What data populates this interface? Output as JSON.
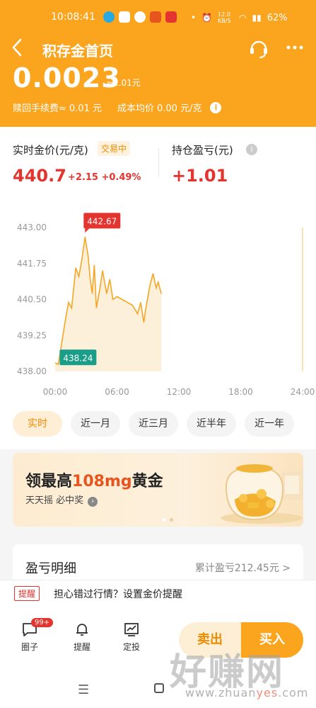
{
  "status": {
    "time": "10:08:41",
    "net_speed": "12.0 KB/S",
    "battery": "62%"
  },
  "header": {
    "title": "积存金首页",
    "grams": "0.0023",
    "grams_approx": "≈1.01元",
    "fee_label": "赎回手续费≈",
    "fee_value": "0.01 元",
    "cost_label": "成本均价",
    "cost_value": "0.00 元/克"
  },
  "price_panel": {
    "price_label": "实时金价(元/克)",
    "trading_badge": "交易中",
    "price": "440.7",
    "change": "+2.15 +0.49%",
    "pnl_label": "持仓盈亏(元)",
    "pnl_value": "+1.01"
  },
  "chart_data": {
    "type": "line",
    "x_ticks": [
      "00:00",
      "06:00",
      "12:00",
      "18:00",
      "24:00"
    ],
    "y_ticks": [
      "443.00",
      "441.75",
      "440.50",
      "439.25",
      "438.00"
    ],
    "ylim": [
      438.0,
      443.0
    ],
    "xlim_hours": [
      0,
      24
    ],
    "high_label": "442.67",
    "low_label": "438.24",
    "series": [
      {
        "x": [
          0.0,
          0.3,
          0.6,
          1.0,
          1.3,
          1.6,
          2.0,
          2.3,
          2.6,
          2.9,
          3.2,
          3.4,
          3.6,
          3.8,
          4.0,
          4.3,
          4.6,
          5.0,
          5.3,
          5.6,
          6.0,
          6.5,
          7.0,
          7.5,
          8.0,
          8.3,
          8.6,
          8.8,
          9.0,
          9.2,
          9.5,
          9.8,
          10.0,
          10.3
        ],
        "y": [
          438.3,
          438.24,
          438.9,
          439.8,
          440.4,
          440.2,
          441.6,
          441.3,
          441.9,
          442.67,
          442.0,
          441.2,
          440.7,
          441.7,
          440.2,
          440.8,
          441.5,
          440.7,
          441.2,
          440.5,
          440.6,
          440.5,
          440.4,
          440.3,
          440.0,
          440.4,
          439.7,
          440.2,
          440.6,
          441.0,
          441.4,
          440.9,
          441.1,
          440.7
        ]
      }
    ]
  },
  "ranges": [
    "实时",
    "近一月",
    "近三月",
    "近半年",
    "近一年"
  ],
  "banner": {
    "title_pre": "领最高",
    "title_hl": "108mg",
    "title_post": "黄金",
    "sub": "天天摇 必中奖"
  },
  "pnl_card": {
    "title": "盈亏明细",
    "total": "累计盈亏212.45元 >"
  },
  "alert": {
    "tag": "提醒",
    "text": "担心错过行情？设置金价提醒"
  },
  "bottom": {
    "tab_circle": "圈子",
    "circle_badge": "99+",
    "tab_remind": "提醒",
    "tab_invest": "定投",
    "sell": "卖出",
    "buy": "买入"
  },
  "watermark": {
    "text": "好赚网",
    "url_a": "www.zhuan",
    "url_b": "yes",
    "url_c": ".com"
  }
}
